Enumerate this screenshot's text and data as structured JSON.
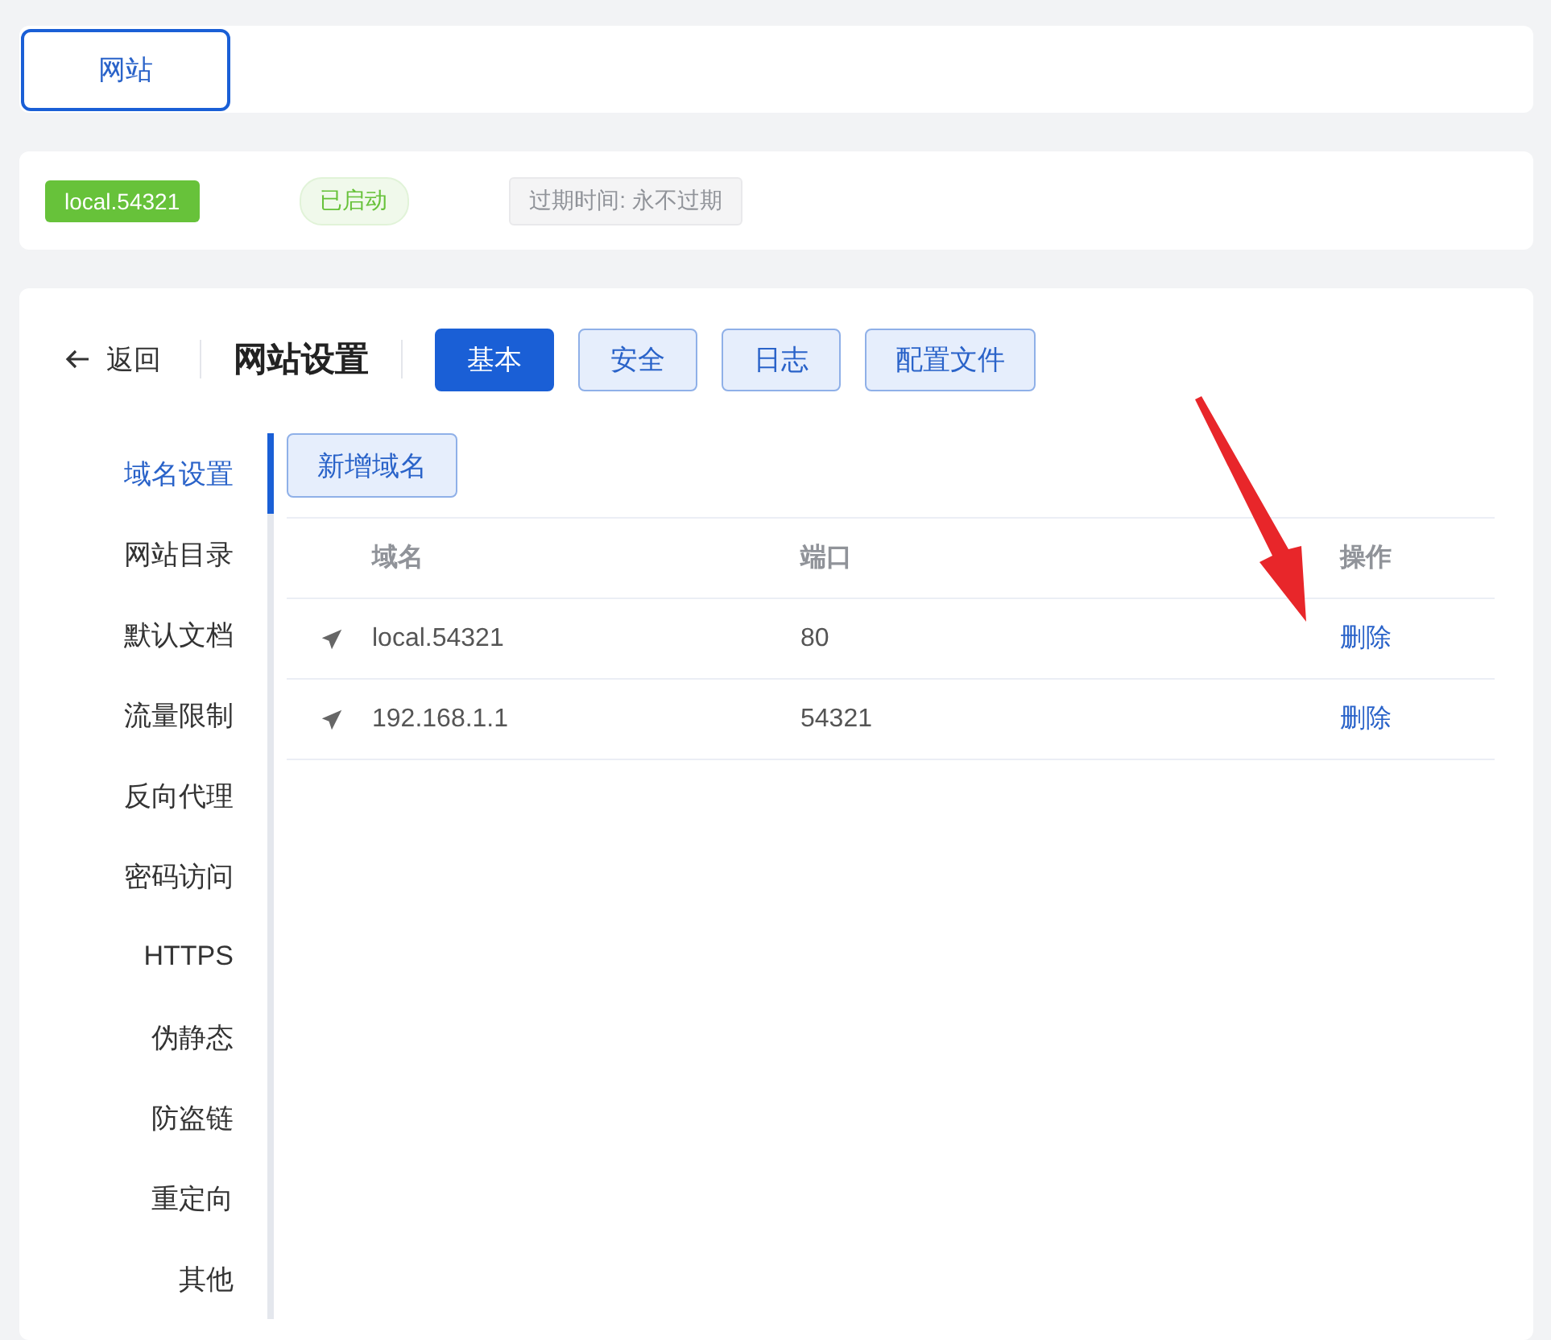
{
  "top_tabs": [
    {
      "label": "网站",
      "selected": true
    }
  ],
  "site": {
    "name": "local.54321",
    "status": "已启动",
    "expiry": "过期时间: 永不过期"
  },
  "header": {
    "back": "返回",
    "title": "网站设置",
    "tabs": [
      {
        "label": "基本",
        "selected": true
      },
      {
        "label": "安全",
        "selected": false
      },
      {
        "label": "日志",
        "selected": false
      },
      {
        "label": "配置文件",
        "selected": false
      }
    ]
  },
  "sidebar": {
    "items": [
      {
        "label": "域名设置",
        "selected": true
      },
      {
        "label": "网站目录",
        "selected": false
      },
      {
        "label": "默认文档",
        "selected": false
      },
      {
        "label": "流量限制",
        "selected": false
      },
      {
        "label": "反向代理",
        "selected": false
      },
      {
        "label": "密码访问",
        "selected": false
      },
      {
        "label": "HTTPS",
        "selected": false
      },
      {
        "label": "伪静态",
        "selected": false
      },
      {
        "label": "防盗链",
        "selected": false
      },
      {
        "label": "重定向",
        "selected": false
      },
      {
        "label": "其他",
        "selected": false
      }
    ]
  },
  "add_button": "新增域名",
  "table": {
    "columns": [
      "域名",
      "端口",
      "操作"
    ],
    "rows": [
      {
        "domain": "local.54321",
        "port": "80",
        "action": "删除"
      },
      {
        "domain": "192.168.1.1",
        "port": "54321",
        "action": "删除"
      }
    ]
  }
}
